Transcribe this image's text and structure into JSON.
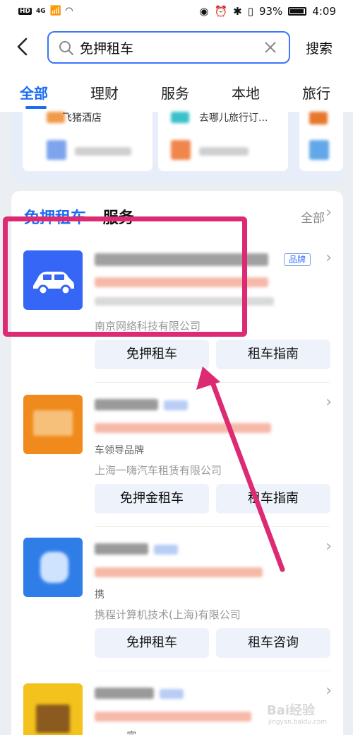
{
  "status_bar": {
    "network": "4G",
    "battery": "93%",
    "time": "4:09"
  },
  "search": {
    "query": "免押租车",
    "button_label": "搜索"
  },
  "tabs": [
    {
      "label": "全部"
    },
    {
      "label": "理财"
    },
    {
      "label": "服务"
    },
    {
      "label": "本地"
    },
    {
      "label": "旅行"
    }
  ],
  "prev_results": [
    {
      "label": "飞猪酒店"
    },
    {
      "label": "去哪儿旅行订..."
    }
  ],
  "service_section": {
    "title_highlight": "免押租车",
    "title_rest": "服务",
    "all_label": "全部"
  },
  "services": [
    {
      "company": "南京网络科技有限公司",
      "badge": "品牌",
      "buttons": [
        "免押租车",
        "租车指南"
      ]
    },
    {
      "company": "上海一嗨汽车租赁有限公司",
      "partial_text": "车领导品牌",
      "buttons": [
        "免押金租车",
        "租车指南"
      ]
    },
    {
      "company": "携程计算机技术(上海)有限公司",
      "partial_text": "携",
      "buttons": [
        "免押租车",
        "租车咨询"
      ]
    },
    {
      "partial_text": "...完..."
    }
  ],
  "colors": {
    "accent": "#1b6cf2",
    "annotation": "#dc2b73"
  },
  "watermark": {
    "text": "Bai经验",
    "sub": "jingyan.baidu.com"
  }
}
